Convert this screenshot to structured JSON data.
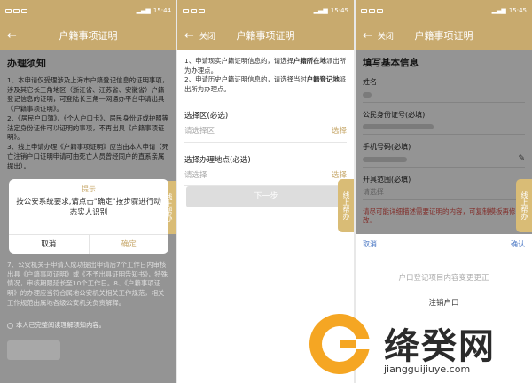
{
  "panels": [
    {
      "time": "15:44",
      "title": "户籍事项证明"
    },
    {
      "time": "15:45",
      "title": "户籍事项证明",
      "close_label": "关闭"
    },
    {
      "time": "15:45",
      "title": "户籍事项证明",
      "close_label": "关闭"
    }
  ],
  "panel1": {
    "section_title": "办理须知",
    "notice": [
      "1、本申请仅受理涉及上海市户籍登记信息的证明事项，涉及其它长三角地区（浙江省、江苏省、安徽省）户籍登记信息的证明，可登陆长三角一网通办平台申请出具《户籍事项证明》。",
      "2、《居民户口簿》、《个人户口卡》、居民身份证或护照等法定身份证件可以证明的事项，不再出具《户籍事项证明》。",
      "3、线上申请办理《户籍事项证明》应当由本人申请（死亡注销户口证明申请可由死亡人员曾经同户的直系亲属提出）。"
    ],
    "notice_lower": "7、公安机关于申请人成功提出申请后7个工作日内审核出具《户籍事项证明》或《不予出具证明告知书》，特殊情况，审核期限延长至10个工作日。8、《户籍事项证明》的办理应当符合属地公安机关相关工作规范，相关工作规范由属地各级公安机关负责解释。",
    "agree_text": "本人已完整阅读理解须知内容。",
    "side_tab": "线上帮办",
    "dialog": {
      "title": "提示",
      "message": "按公安系统要求,请点击\"确定\"按步骤进行动态实人识别",
      "cancel": "取消",
      "confirm": "确定"
    }
  },
  "panel2": {
    "instructions": [
      {
        "pre": "1、申请现实户籍证明信息的，请选择",
        "bold": "户籍所在地",
        "post": "派出所为办理点。"
      },
      {
        "pre": "2、申请历史户籍证明信息的，请选择当时",
        "bold": "户籍登记地",
        "post": "派出所为办理点。"
      }
    ],
    "district_label": "选择区(必选)",
    "district_placeholder": "请选择区",
    "office_label": "选择办理地点(必选)",
    "office_placeholder": "请选择",
    "select_label": "选择",
    "next_button": "下一步",
    "side_tab": "线上帮办"
  },
  "panel3": {
    "section_title": "填写基本信息",
    "name_label": "姓名",
    "id_label": "公民身份证号(必填)",
    "phone_label": "手机号码(必填)",
    "scope_label": "开具范围(必填)",
    "scope_placeholder": "请选择",
    "hint": "请尽可能详细描述需要证明的内容，可复制模板再修改。",
    "side_tab": "线上帮办",
    "sheet": {
      "cancel": "取消",
      "confirm": "确认",
      "options": [
        "户口登记项目内容变更更正",
        "注销户口"
      ]
    }
  },
  "watermark": {
    "title": "绛癸网",
    "url": "jiangguijiuye.com",
    "color": "#f5a623"
  }
}
